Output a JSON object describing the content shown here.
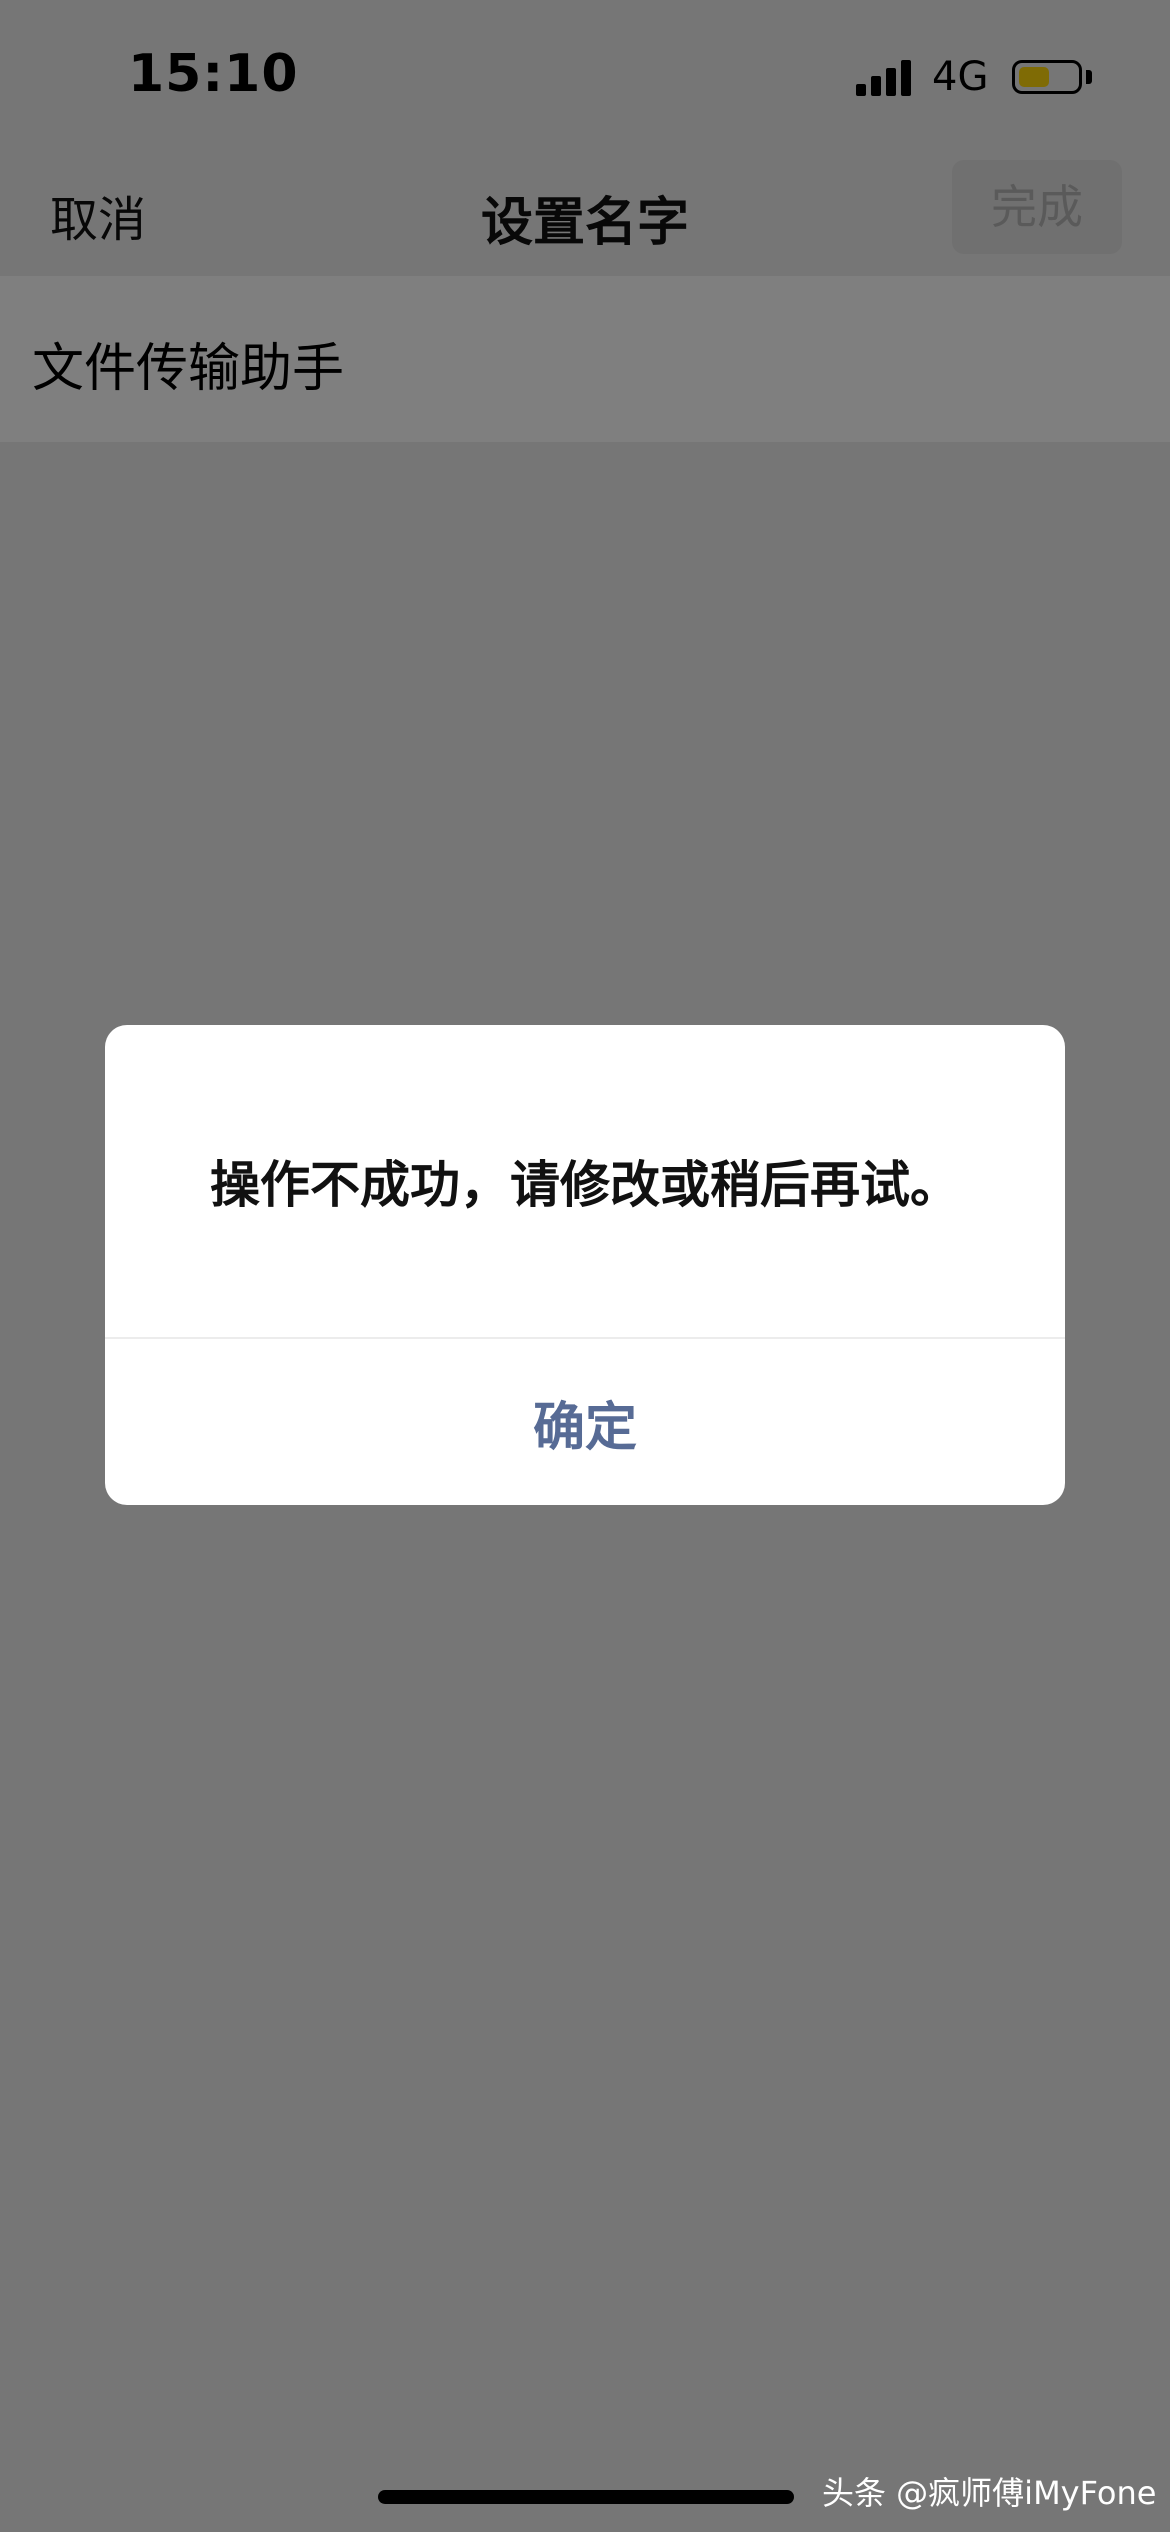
{
  "status_bar": {
    "time": "15:10",
    "network": "4G",
    "battery_color": "#ffd60a"
  },
  "nav": {
    "cancel_label": "取消",
    "title": "设置名字",
    "done_label": "完成"
  },
  "name_field": {
    "value": "文件传输助手"
  },
  "dialog": {
    "message": "操作不成功，请修改或稍后再试。",
    "confirm_label": "确定",
    "confirm_color": "#576b95"
  },
  "watermark": "头条 @疯师傅iMyFone"
}
